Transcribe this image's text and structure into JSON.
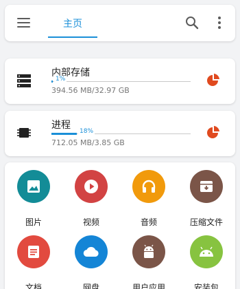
{
  "header": {
    "tab_home": "主页"
  },
  "storage_cards": [
    {
      "title": "内部存储",
      "usage": "394.56 MB/32.97 GB",
      "percent_label": "1%",
      "fill_fraction": 0.01
    },
    {
      "title": "进程",
      "usage": "712.05 MB/3.85 GB",
      "percent_label": "18%",
      "fill_fraction": 0.18
    }
  ],
  "categories": [
    {
      "label": "图片",
      "icon": "image-icon",
      "color": "#138c97"
    },
    {
      "label": "视频",
      "icon": "play-icon",
      "color": "#d24343"
    },
    {
      "label": "音频",
      "icon": "headphones-icon",
      "color": "#f19a0c"
    },
    {
      "label": "压缩文件",
      "icon": "archive-icon",
      "color": "#7b5548"
    },
    {
      "label": "文档",
      "icon": "document-icon",
      "color": "#e24a3f"
    },
    {
      "label": "网盘",
      "icon": "cloud-icon",
      "color": "#1485d6"
    },
    {
      "label": "用户应用",
      "icon": "android-icon",
      "color": "#7b5548"
    },
    {
      "label": "安装包",
      "icon": "android-icon",
      "color": "#87c340"
    }
  ],
  "colors": {
    "accent": "#1a8fd8",
    "pie": "#e04a1f"
  }
}
